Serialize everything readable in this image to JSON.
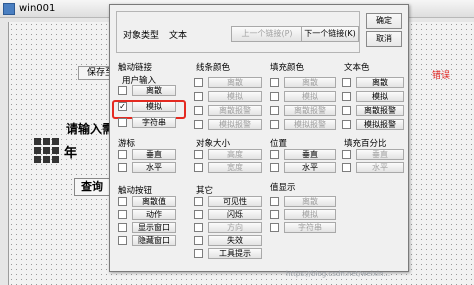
{
  "window_title": "win001",
  "background": {
    "save_btn": "保存至文",
    "prompt": "请输入需要",
    "year_char": "年",
    "query_btn": "查询",
    "error_text": "错误"
  },
  "dialog": {
    "object_type_label": "对象类型",
    "object_type_value": "文本",
    "prev_link_btn": "上一个链接(P)",
    "next_link_btn": "下一个链接(K)",
    "ok_btn": "确定",
    "cancel_btn": "取消",
    "touch_link": {
      "title": "触动链接",
      "user_input": "用户输入",
      "items": [
        {
          "label": "离散",
          "checked": false
        },
        {
          "label": "模拟",
          "checked": true
        },
        {
          "label": "字符串",
          "checked": false
        }
      ],
      "cursor_title": "游标",
      "cursor_items": [
        {
          "label": "垂直",
          "checked": false
        },
        {
          "label": "水平",
          "checked": false
        }
      ],
      "button_title": "触动按钮",
      "button_items": [
        {
          "label": "离散值",
          "checked": false
        },
        {
          "label": "动作",
          "checked": false
        },
        {
          "label": "显示窗口",
          "checked": false
        },
        {
          "label": "隐藏窗口",
          "checked": false
        }
      ]
    },
    "line_color": {
      "title": "线条颜色",
      "items": [
        {
          "label": "离散",
          "checked": false
        },
        {
          "label": "模拟",
          "checked": false
        },
        {
          "label": "离散报警",
          "checked": false
        },
        {
          "label": "模拟报警",
          "checked": false
        }
      ]
    },
    "fill_color": {
      "title": "填充颜色",
      "items": [
        {
          "label": "离散",
          "checked": false
        },
        {
          "label": "模拟",
          "checked": false
        },
        {
          "label": "离散报警",
          "checked": false
        },
        {
          "label": "模拟报警",
          "checked": false
        }
      ]
    },
    "text_color": {
      "title": "文本色",
      "items": [
        {
          "label": "离散",
          "checked": false
        },
        {
          "label": "模拟",
          "checked": false
        },
        {
          "label": "离散报警",
          "checked": false
        },
        {
          "label": "模拟报警",
          "checked": false
        }
      ]
    },
    "object_size": {
      "title": "对象大小",
      "items": [
        {
          "label": "高度",
          "checked": false
        },
        {
          "label": "宽度",
          "checked": false
        }
      ]
    },
    "position": {
      "title": "位置",
      "items": [
        {
          "label": "垂直",
          "checked": false
        },
        {
          "label": "水平",
          "checked": false
        }
      ]
    },
    "fill_percent": {
      "title": "填充百分比",
      "items": [
        {
          "label": "垂直",
          "checked": false
        },
        {
          "label": "水平",
          "checked": false
        }
      ]
    },
    "other": {
      "title": "其它",
      "items": [
        {
          "label": "可见性",
          "checked": false
        },
        {
          "label": "闪烁",
          "checked": false
        },
        {
          "label": "方向",
          "checked": false
        },
        {
          "label": "失效",
          "checked": false
        },
        {
          "label": "工具提示",
          "checked": false
        }
      ]
    },
    "value_display": {
      "title": "值显示",
      "items": [
        {
          "label": "离散",
          "checked": false
        },
        {
          "label": "模拟",
          "checked": false
        },
        {
          "label": "字符串",
          "checked": false
        }
      ]
    }
  },
  "watermark": "https://blog.csdn.net/weixin..."
}
